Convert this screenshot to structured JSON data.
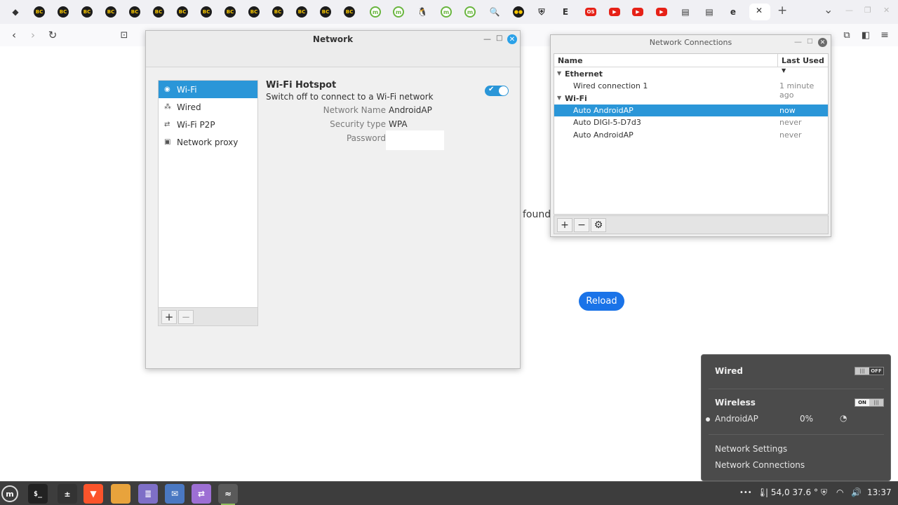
{
  "browser": {
    "tabs": [
      {
        "icon": "vault-icon",
        "glyph": "◆",
        "style": "plain"
      },
      {
        "icon": "bitcoin-icon",
        "glyph": "BC",
        "style": "dark"
      },
      {
        "icon": "bitcoin-icon",
        "glyph": "BC",
        "style": "dark"
      },
      {
        "icon": "bitcoin-icon",
        "glyph": "BC",
        "style": "dark"
      },
      {
        "icon": "bitcoin-icon",
        "glyph": "BC",
        "style": "dark"
      },
      {
        "icon": "bitcoin-icon",
        "glyph": "BC",
        "style": "dark"
      },
      {
        "icon": "bitcoin-icon",
        "glyph": "BC",
        "style": "dark"
      },
      {
        "icon": "bitcoin-icon",
        "glyph": "BC",
        "style": "dark"
      },
      {
        "icon": "bitcoin-icon",
        "glyph": "BC",
        "style": "dark"
      },
      {
        "icon": "bitcoin-icon",
        "glyph": "BC",
        "style": "dark"
      },
      {
        "icon": "bitcoin-icon",
        "glyph": "BC",
        "style": "dark"
      },
      {
        "icon": "bitcoin-icon",
        "glyph": "BC",
        "style": "dark"
      },
      {
        "icon": "bitcoin-icon",
        "glyph": "BC",
        "style": "dark"
      },
      {
        "icon": "bitcoin-icon",
        "glyph": "BC",
        "style": "dark"
      },
      {
        "icon": "bitcoin-icon",
        "glyph": "BC",
        "style": "dark"
      },
      {
        "icon": "mint-icon",
        "glyph": "m",
        "style": "mint"
      },
      {
        "icon": "mint-icon",
        "glyph": "m",
        "style": "mint"
      },
      {
        "icon": "penguin-icon",
        "glyph": "🐧",
        "style": "plain"
      },
      {
        "icon": "mint-icon",
        "glyph": "m",
        "style": "mint"
      },
      {
        "icon": "mint-icon",
        "glyph": "m",
        "style": "mint"
      },
      {
        "icon": "search-icon",
        "glyph": "🔍",
        "style": "plain"
      },
      {
        "icon": "medium-icon",
        "glyph": "●●",
        "style": "dark"
      },
      {
        "icon": "shield-icon",
        "glyph": "⛨",
        "style": "plain"
      },
      {
        "icon": "e-icon",
        "glyph": "E",
        "style": "plain"
      },
      {
        "icon": "os-icon",
        "glyph": "OS",
        "style": "yt"
      },
      {
        "icon": "youtube-icon",
        "glyph": "▶",
        "style": "yt"
      },
      {
        "icon": "youtube-icon",
        "glyph": "▶",
        "style": "yt"
      },
      {
        "icon": "youtube-icon",
        "glyph": "▶",
        "style": "yt"
      },
      {
        "icon": "document-icon",
        "glyph": "▤",
        "style": "plain"
      },
      {
        "icon": "document-icon",
        "glyph": "▤",
        "style": "plain"
      },
      {
        "icon": "edge-icon",
        "glyph": "e",
        "style": "plain"
      }
    ],
    "close_tab_glyph": "✕",
    "new_tab_glyph": "+",
    "tab_list_glyph": "⌄",
    "window_minimize": "—",
    "window_restore": "❐",
    "window_close": "✕"
  },
  "page": {
    "found_text": "found",
    "reload_label": "Reload"
  },
  "network_window": {
    "title": "Network",
    "sidebar": [
      {
        "label": "Wi-Fi",
        "icon": "wifi-icon",
        "glyph": "◉"
      },
      {
        "label": "Wired",
        "icon": "wired-icon",
        "glyph": "⁂"
      },
      {
        "label": "Wi-Fi P2P",
        "icon": "p2p-icon",
        "glyph": "⇄"
      },
      {
        "label": "Network proxy",
        "icon": "proxy-icon",
        "glyph": "▣"
      }
    ],
    "add_glyph": "+",
    "remove_glyph": "−",
    "hotspot_title": "Wi-Fi Hotspot",
    "hotspot_subtitle": "Switch off to connect to a Wi-Fi network",
    "fields": {
      "network_name_label": "Network Name",
      "network_name_value": "AndroidAP",
      "security_type_label": "Security type",
      "security_type_value": "WPA",
      "password_label": "Password"
    }
  },
  "connections_window": {
    "title": "Network Connections",
    "col_name": "Name",
    "col_last_used": "Last Used",
    "rows": [
      {
        "type": "group",
        "name": "Ethernet",
        "used": ""
      },
      {
        "type": "item",
        "name": "Wired connection 1",
        "used": "1 minute ago"
      },
      {
        "type": "group",
        "name": "Wi-Fi",
        "used": ""
      },
      {
        "type": "item",
        "name": "Auto AndroidAP",
        "used": "now",
        "selected": true
      },
      {
        "type": "item",
        "name": "Auto DIGI-5-D7d3",
        "used": "never"
      },
      {
        "type": "item",
        "name": "Auto AndroidAP",
        "used": "never"
      }
    ],
    "add_glyph": "+",
    "remove_glyph": "−",
    "settings_glyph": "⚙"
  },
  "tray_popup": {
    "wired_label": "Wired",
    "wired_state": "OFF",
    "wireless_label": "Wireless",
    "wireless_state": "ON",
    "network_name": "AndroidAP",
    "signal": "0%",
    "network_settings": "Network Settings",
    "network_connections": "Network Connections"
  },
  "taskbar": {
    "temp_text": "54,0",
    "temp2_text": "37.6 °",
    "clock": "13:37",
    "dots": "•••"
  }
}
